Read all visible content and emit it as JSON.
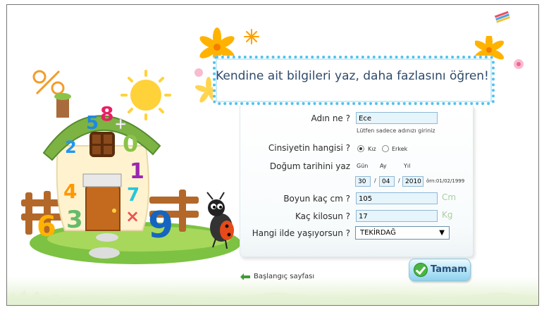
{
  "banner": {
    "title": "Kendine ait bilgileri yaz, daha fazlasını öğren!"
  },
  "form": {
    "name": {
      "label": "Adın ne ?",
      "value": "Ece",
      "hint": "Lütfen sadece adınızı giriniz"
    },
    "gender": {
      "label": "Cinsiyetin hangisi ?",
      "options": [
        "Kız",
        "Erkek"
      ],
      "selected": "Kız"
    },
    "birth": {
      "label": "Doğum tarihini yaz",
      "day_label": "Gün",
      "month_label": "Ay",
      "year_label": "Yıl",
      "day": "30",
      "month": "04",
      "year": "2010",
      "separator": "/",
      "example": "örn:01/02/1999"
    },
    "height": {
      "label": "Boyun kaç cm ?",
      "value": "105",
      "unit": "Cm"
    },
    "weight": {
      "label": "Kaç kilosun ?",
      "value": "17",
      "unit": "Kg"
    },
    "city": {
      "label": "Hangi ilde yaşıyorsun ?",
      "value": "TEKİRDAĞ",
      "arrow": "▼"
    }
  },
  "buttons": {
    "submit": "Tamam"
  },
  "nav": {
    "home": "Başlangıç sayfası"
  },
  "colors": {
    "banner_border": "#52c2ee",
    "input_bg": "#e6f4fb",
    "button_bg": "#b9e6f7",
    "unit_color": "#a8cfa2"
  },
  "decorations": {
    "house_numbers": [
      "5",
      "8",
      "2",
      "0",
      "1",
      "4",
      "7",
      "6",
      "3",
      "9"
    ],
    "house_symbols": [
      "+",
      "×",
      "%"
    ]
  }
}
